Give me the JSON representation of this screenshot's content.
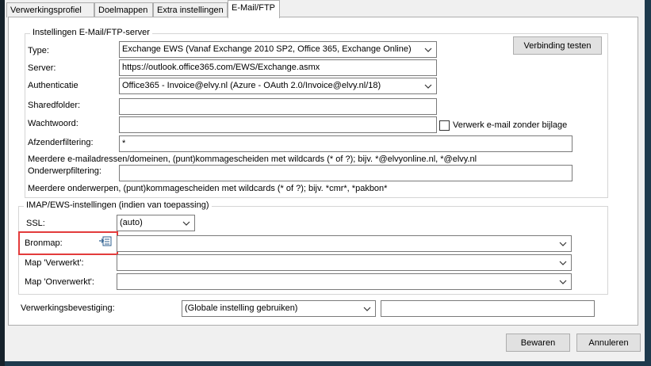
{
  "tabs": [
    {
      "label": "Verwerkingsprofiel"
    },
    {
      "label": "Doelmappen"
    },
    {
      "label": "Extra instellingen"
    },
    {
      "label": "E-Mail/FTP"
    }
  ],
  "server_group": {
    "title": "Instellingen E-Mail/FTP-server",
    "test_button": "Verbinding testen",
    "type_label": "Type:",
    "type_value": "Exchange EWS (Vanaf Exchange 2010 SP2, Office 365, Exchange Online)",
    "server_label": "Server:",
    "server_value": "https://outlook.office365.com/EWS/Exchange.asmx",
    "auth_label": "Authenticatie",
    "auth_value": "Office365 - Invoice@elvy.nl (Azure - OAuth 2.0/Invoice@elvy.nl/18)",
    "sharedfolder_label": "Sharedfolder:",
    "sharedfolder_value": "",
    "password_label": "Wachtwoord:",
    "password_value": "",
    "no_attachment_label": "Verwerk e-mail zonder bijlage",
    "no_attachment_checked": false,
    "sender_filter_label": "Afzenderfiltering:",
    "sender_filter_value": "*",
    "sender_hint": "Meerdere e-mailadressen/domeinen, (punt)kommagescheiden met wildcards (* of ?); bijv. *@elvyonline.nl, *@elvy.nl",
    "subject_filter_label": "Onderwerpfiltering:",
    "subject_filter_value": "",
    "subject_hint": "Meerdere onderwerpen, (punt)kommagescheiden met wildcards (* of ?); bijv. *cmr*, *pakbon*"
  },
  "imap_group": {
    "title": "IMAP/EWS-instellingen (indien van toepassing)",
    "ssl_label": "SSL:",
    "ssl_value": "(auto)",
    "source_label": "Bronmap:",
    "source_value": "",
    "processed_label": "Map 'Verwerkt':",
    "processed_value": "",
    "unprocessed_label": "Map 'Onverwerkt':",
    "unprocessed_value": ""
  },
  "confirmation": {
    "label": "Verwerkingsbevestiging:",
    "value": "(Globale instelling gebruiken)",
    "extra_value": ""
  },
  "footer": {
    "save_label": "Bewaren",
    "cancel_label": "Annuleren"
  },
  "colors": {
    "highlight": "#e33b3b",
    "frame": "#1e3a4d"
  }
}
